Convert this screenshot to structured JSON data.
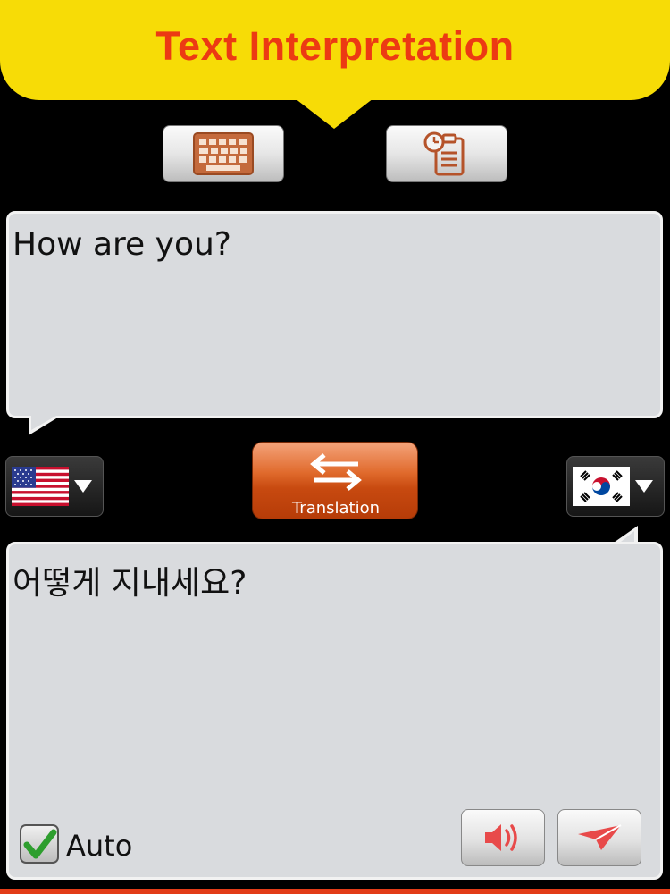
{
  "header": {
    "title": "Text Interpretation"
  },
  "toolbar": {
    "keyboard_icon": "keyboard-icon",
    "history_icon": "clipboard-history-icon"
  },
  "source": {
    "text": "How are you?",
    "language_flag": "us-flag-icon"
  },
  "target": {
    "text": "어떻게 지내세요?",
    "language_flag": "korea-flag-icon"
  },
  "translate": {
    "label": "Translation",
    "icon": "swap-arrows-icon"
  },
  "auto": {
    "label": "Auto",
    "checked": true
  },
  "actions": {
    "speak_icon": "speaker-icon",
    "send_icon": "paper-plane-icon"
  },
  "colors": {
    "banner": "#f7dc06",
    "title": "#ec3a13",
    "box": "#d9dbde",
    "translate_button": "#c84a10",
    "icon_accent": "#b5532a",
    "action_red": "#e84a4a"
  }
}
